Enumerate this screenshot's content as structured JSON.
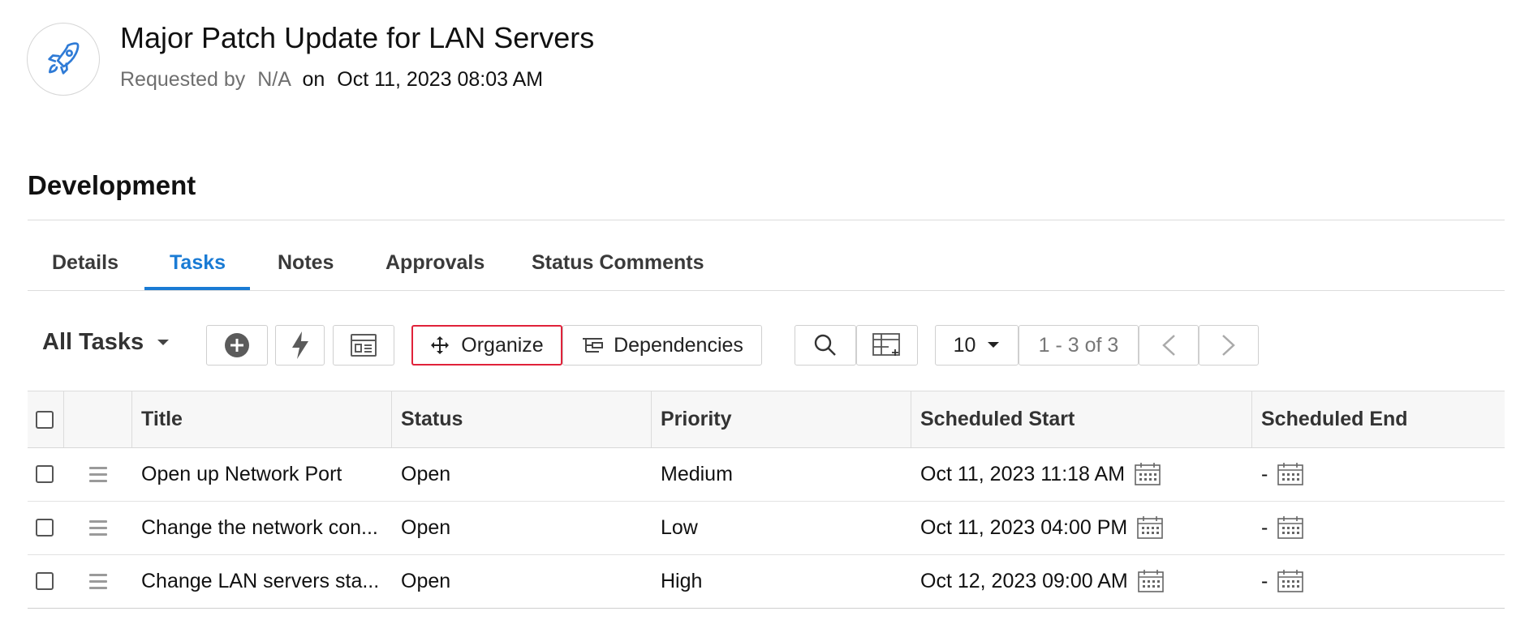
{
  "header": {
    "icon": "rocket-icon",
    "title": "Major Patch Update for LAN Servers",
    "requested_by_label": "Requested by",
    "requester": "N/A",
    "on_label": "on",
    "requested_on": "Oct 11, 2023 08:03 AM"
  },
  "stage": {
    "title": "Development"
  },
  "tabs": [
    {
      "label": "Details",
      "active": false
    },
    {
      "label": "Tasks",
      "active": true
    },
    {
      "label": "Notes",
      "active": false
    },
    {
      "label": "Approvals",
      "active": false
    },
    {
      "label": "Status Comments",
      "active": false
    }
  ],
  "toolbar": {
    "filter_label": "All Tasks",
    "add_icon": "add-circle-icon",
    "trigger_icon": "lightning-icon",
    "template_icon": "template-icon",
    "organize_label": "Organize",
    "dependencies_label": "Dependencies",
    "search_icon": "search-icon",
    "columns_icon": "column-chooser-icon",
    "page_size": "10",
    "page_range": "1 - 3 of 3",
    "prev_icon": "chevron-left-icon",
    "next_icon": "chevron-right-icon"
  },
  "table": {
    "columns": [
      "Title",
      "Status",
      "Priority",
      "Scheduled Start",
      "Scheduled End"
    ],
    "rows": [
      {
        "title": "Open up Network Port",
        "status": "Open",
        "priority": "Medium",
        "start": "Oct 11, 2023 11:18 AM",
        "end": "-"
      },
      {
        "title": "Change the network con...",
        "status": "Open",
        "priority": "Low",
        "start": "Oct 11, 2023 04:00 PM",
        "end": "-"
      },
      {
        "title": "Change LAN servers sta...",
        "status": "Open",
        "priority": "High",
        "start": "Oct 12, 2023 09:00 AM",
        "end": "-"
      }
    ]
  },
  "colors": {
    "accent": "#1a7bd4",
    "highlight": "#e0223a"
  }
}
